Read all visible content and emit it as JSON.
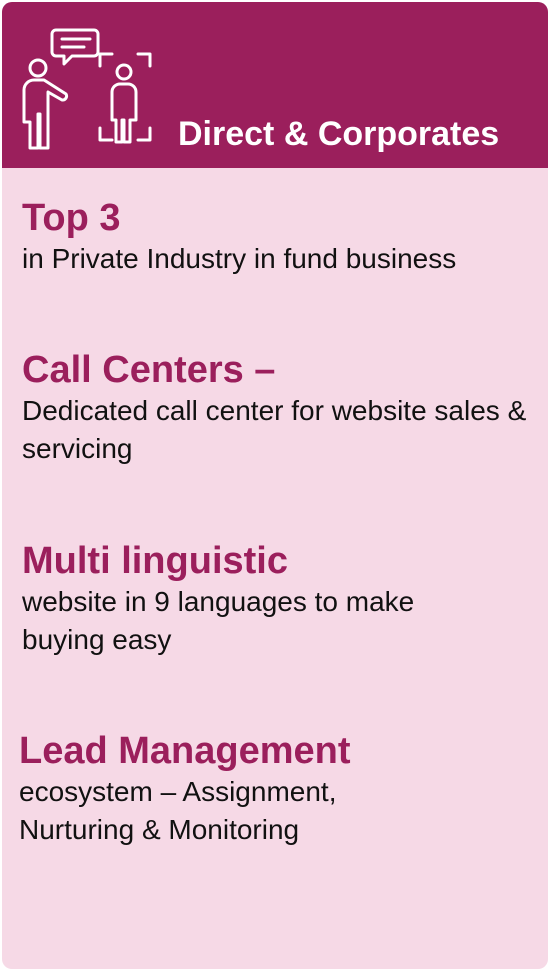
{
  "header": {
    "title": "Direct & Corporates",
    "icon": "presenter-audience-icon"
  },
  "colors": {
    "header_bg": "#9b1f5c",
    "card_bg": "#f6d9e6",
    "title_text": "#9b1f5c",
    "body_text": "#111111"
  },
  "blocks": [
    {
      "title": "Top 3",
      "text": "in Private Industry in fund business"
    },
    {
      "title": "Call Centers –",
      "text": "Dedicated call center for website sales & servicing"
    },
    {
      "title": "Multi linguistic",
      "text": "website in 9 languages to make buying easy"
    },
    {
      "title": "Lead Management",
      "text": "ecosystem – Assignment, Nurturing & Monitoring"
    }
  ]
}
